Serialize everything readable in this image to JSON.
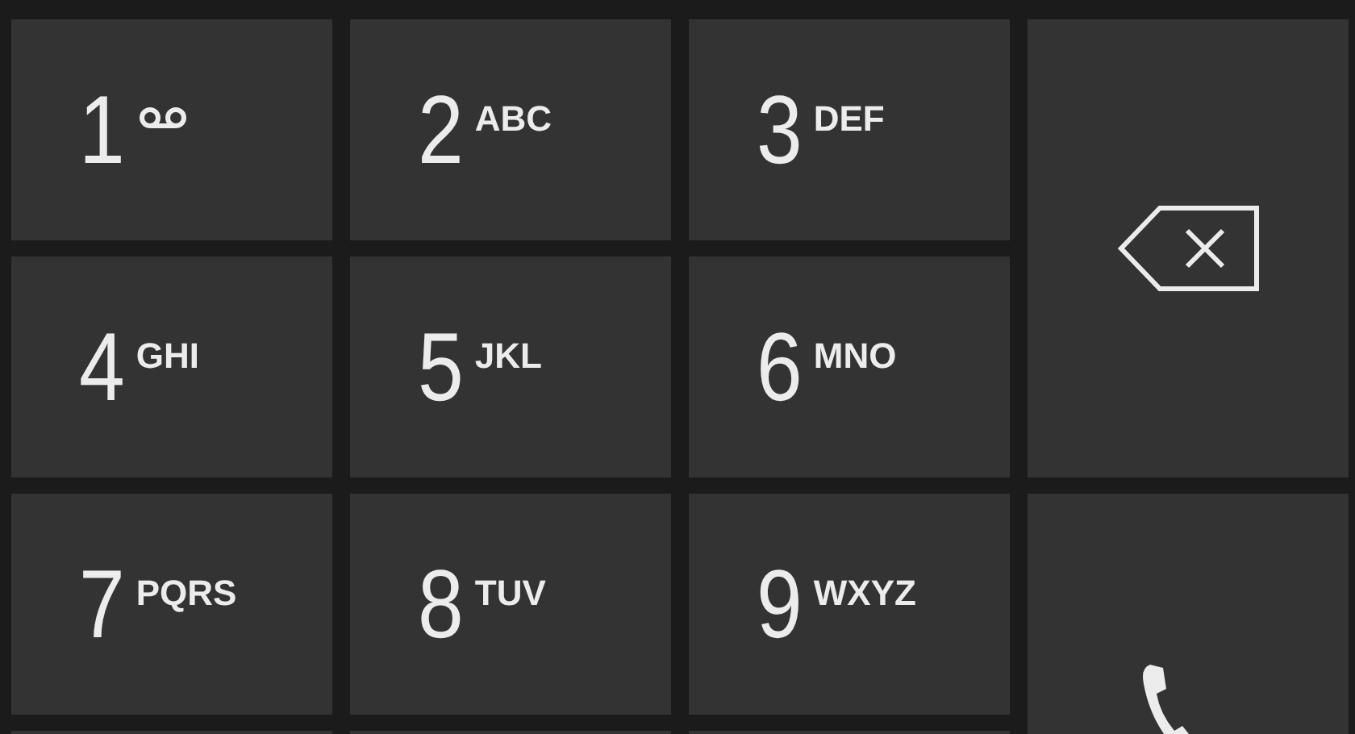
{
  "keys": [
    {
      "kind": "voicemail",
      "digit": "1"
    },
    {
      "kind": "digit",
      "digit": "2",
      "letters": "ABC"
    },
    {
      "kind": "digit",
      "digit": "3",
      "letters": "DEF"
    },
    {
      "kind": "digit",
      "digit": "4",
      "letters": "GHI"
    },
    {
      "kind": "digit",
      "digit": "5",
      "letters": "JKL"
    },
    {
      "kind": "digit",
      "digit": "6",
      "letters": "MNO"
    },
    {
      "kind": "digit",
      "digit": "7",
      "letters": "PQRS"
    },
    {
      "kind": "digit",
      "digit": "8",
      "letters": "TUV"
    },
    {
      "kind": "digit",
      "digit": "9",
      "letters": "WXYZ"
    }
  ],
  "side_buttons": [
    {
      "kind": "backspace"
    },
    {
      "kind": "call"
    }
  ]
}
